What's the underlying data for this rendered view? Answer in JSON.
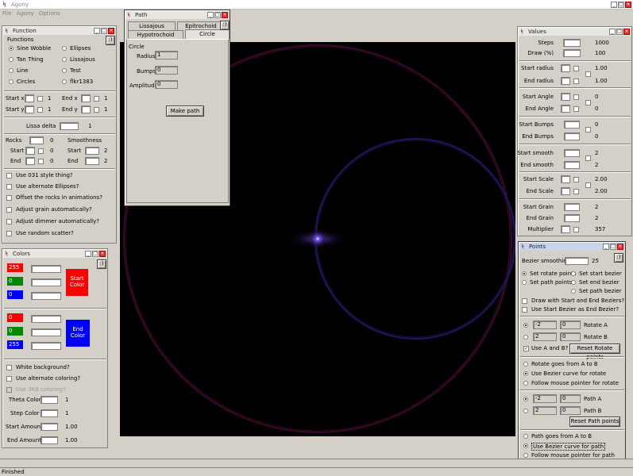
{
  "app": {
    "title": "Agony",
    "status": "Finished"
  },
  "menu": [
    "File",
    "Agony",
    "Options"
  ],
  "function_win": {
    "title": "Function",
    "group_label": "Functions",
    "functions": [
      "Sine Wobble",
      "Ellipses",
      "Tan Thing",
      "Lissajous",
      "Line",
      "Test",
      "Circles",
      "flkr1383"
    ],
    "selected": "Sine Wobble",
    "start_x_label": "Start x",
    "start_x_val": "1",
    "end_x_label": "End x",
    "end_x_val": "1",
    "start_y_label": "Start y",
    "start_y_val": "1",
    "end_y_label": "End y",
    "end_y_val": "1",
    "lissa_delta_label": "Lissa delta",
    "lissa_delta_val": "1",
    "rocks_label": "Rocks",
    "rocks_val": "0",
    "smoothness_label": "Smoothness",
    "rocks_start_label": "Start",
    "rocks_start_val": "0",
    "rocks_end_label": "End",
    "rocks_end_val": "0",
    "smooth_start_label": "Start",
    "smooth_start_val": "2",
    "smooth_end_label": "End",
    "smooth_end_val": "2",
    "checks": [
      "Use 031 style thing?",
      "Use alternate Ellipses?",
      "Offset the rocks in animations?",
      "Adjust grain automatically?",
      "Adjust dimmer automatically?",
      "Use random scatter?"
    ],
    "smiley": ":)"
  },
  "path_win": {
    "title": "Path",
    "tabs": [
      "Lissajous",
      "Epitrochoid",
      "Hypotrochoid",
      "Circle"
    ],
    "section": "Circle",
    "radius_label": "Radius",
    "radius_val": "1",
    "bumps_label": "Bumps",
    "bumps_val": "0",
    "amplitude_label": "Amplitude",
    "amplitude_val": "0",
    "make_path": "Make path",
    "smiley": ":)"
  },
  "colors_win": {
    "title": "Colors",
    "start": {
      "r": "255",
      "g": "0",
      "b": "0",
      "label": "Start Color",
      "color": "#ff0000"
    },
    "end": {
      "r": "0",
      "g": "0",
      "b": "255",
      "label": "End Color",
      "color": "#0000ff"
    },
    "checks": [
      "White background?",
      "Use alternate coloring?",
      "Use 3K8 coloring?"
    ],
    "theta_label": "Theta Color",
    "theta_val": "1",
    "step_label": "Step Color",
    "step_val": "1",
    "start_amount_label": "Start Amount",
    "start_amount_val": "1.00",
    "end_amount_label": "End Amount",
    "end_amount_val": "1.00",
    "smiley": ":)"
  },
  "values_win": {
    "title": "Values",
    "rows": [
      {
        "label": "Steps",
        "val": "1000"
      },
      {
        "label": "Draw (%)",
        "val": "100"
      },
      {
        "label": "Start radius",
        "val": "1.00"
      },
      {
        "label": "End radius",
        "val": "1.00"
      },
      {
        "label": "Start Angle",
        "val": "0"
      },
      {
        "label": "End Angle",
        "val": "0"
      },
      {
        "label": "Start Bumps",
        "val": "0"
      },
      {
        "label": "End Bumps",
        "val": "0"
      },
      {
        "label": "Start smooth",
        "val": "2"
      },
      {
        "label": "End smooth",
        "val": "2"
      },
      {
        "label": "Start Scale",
        "val": "2.00"
      },
      {
        "label": "End Scale",
        "val": "2.00"
      },
      {
        "label": "Start Grain",
        "val": "2"
      },
      {
        "label": "End Grain",
        "val": "2"
      },
      {
        "label": "Multiplier",
        "val": "357"
      }
    ]
  },
  "points_win": {
    "title": "Points",
    "bezier_smoothing_label": "Bezier smoothing",
    "bezier_smoothing_val": "25",
    "smiley": ":)",
    "set_rotate": "Set rotate points",
    "set_start_bezier": "Set start bezier",
    "set_path": "Set path points",
    "set_end_bezier": "Set end bezier",
    "set_path_bezier": "Set path bezier",
    "draw_start_end": "Draw with Start and End Beziers?",
    "use_start_as_end": "Use Start Bezier as End Bezier?",
    "rotate_a_x": "-2",
    "rotate_a_y": "0",
    "rotate_a_label": "Rotate A",
    "rotate_b_x": "2",
    "rotate_b_y": "0",
    "rotate_b_label": "Rotate B",
    "use_ab": "Use A and B?",
    "reset_rotate": "Reset Rotate points",
    "rot_opts": [
      "Rotate goes from A to B",
      "Use Bezier curve for rotate",
      "Follow mouse pointer for rotate"
    ],
    "path_a_x": "-2",
    "path_a_y": "0",
    "path_a_label": "Path A",
    "path_b_x": "2",
    "path_b_y": "0",
    "path_b_label": "Path B",
    "reset_path": "Reset Path points",
    "path_opts": [
      "Path goes from A to B",
      "Use Bezier curve for path",
      "Follow mouse pointer for path"
    ]
  }
}
